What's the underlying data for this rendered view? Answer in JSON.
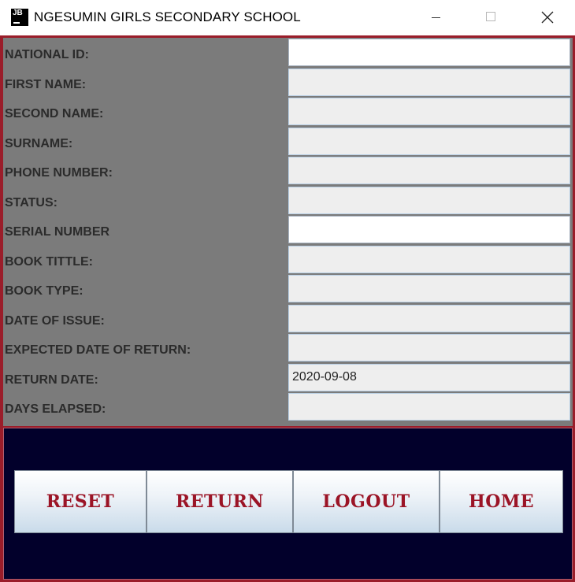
{
  "window": {
    "title": "NGESUMIN GIRLS SECONDARY SCHOOL",
    "icon_text": "JB",
    "icon": "app-jb-icon"
  },
  "form": {
    "fields": [
      {
        "label": "NATIONAL ID:",
        "value": "",
        "editable": true
      },
      {
        "label": "FIRST NAME:",
        "value": "",
        "editable": false
      },
      {
        "label": "SECOND NAME:",
        "value": "",
        "editable": false
      },
      {
        "label": "SURNAME:",
        "value": "",
        "editable": false
      },
      {
        "label": "PHONE NUMBER:",
        "value": "",
        "editable": false
      },
      {
        "label": "STATUS:",
        "value": "",
        "editable": false
      },
      {
        "label": "SERIAL NUMBER",
        "value": "",
        "editable": true
      },
      {
        "label": "BOOK TITTLE:",
        "value": "",
        "editable": false
      },
      {
        "label": "BOOK TYPE:",
        "value": "",
        "editable": false
      },
      {
        "label": "DATE OF ISSUE:",
        "value": "",
        "editable": false
      },
      {
        "label": "EXPECTED DATE OF RETURN:",
        "value": "",
        "editable": false
      },
      {
        "label": "RETURN DATE:",
        "value": "2020-09-08",
        "editable": false
      },
      {
        "label": "DAYS ELAPSED:",
        "value": "",
        "editable": false
      }
    ]
  },
  "buttons": {
    "reset": "RESET",
    "return": "RETURN",
    "logout": "LOGOUT",
    "home": "HOME"
  },
  "colors": {
    "frame_border": "#9a1d2a",
    "form_background": "#7b7b7b",
    "button_panel_background": "#02002b",
    "button_text": "#9b1426"
  }
}
